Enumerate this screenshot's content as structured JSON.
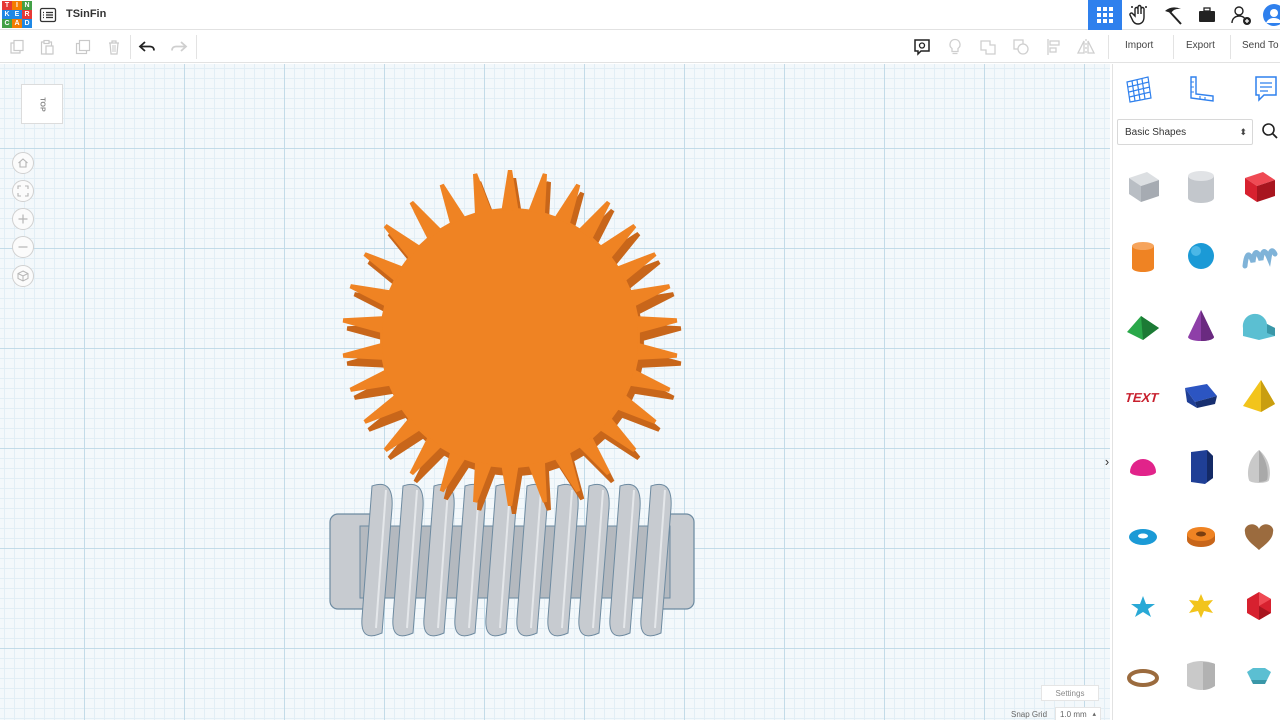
{
  "app": {
    "logo_letters": [
      "T",
      "I",
      "N",
      "K",
      "E",
      "R",
      "C",
      "A",
      "D"
    ],
    "logo_colors": [
      "#e53935",
      "#f57c00",
      "#43a047",
      "#1e88e5",
      "#1e88e5",
      "#e53935",
      "#43a047",
      "#f57c00",
      "#1e88e5"
    ],
    "design_title": "TSinFin"
  },
  "topbar": {
    "icons": [
      {
        "name": "3d-design-icon",
        "active": true
      },
      {
        "name": "blocks-icon",
        "active": false
      },
      {
        "name": "lessons-pickaxe-icon",
        "active": false
      },
      {
        "name": "circuits-briefcase-icon",
        "active": false
      },
      {
        "name": "invite-user-icon",
        "active": false
      },
      {
        "name": "user-avatar-icon",
        "active": false
      }
    ]
  },
  "toolbar": {
    "copy": "copy-icon",
    "paste": "paste-icon",
    "duplicate": "duplicate-icon",
    "delete": "delete-icon",
    "undo": "undo-icon",
    "redo": "redo-icon",
    "notes": "notes-icon",
    "light": "lightbulb-icon",
    "group": "group-icon",
    "ungroup": "ungroup-icon",
    "align": "align-icon",
    "mirror": "mirror-icon",
    "import_label": "Import",
    "export_label": "Export",
    "send_label": "Send To"
  },
  "viewport": {
    "view_label": "TOP",
    "nav": [
      "home-view-icon",
      "fit-view-icon",
      "zoom-in-icon",
      "zoom-out-icon",
      "perspective-icon"
    ],
    "settings_label": "Settings",
    "snap_label": "Snap Grid",
    "snap_value": "1.0 mm"
  },
  "objects": {
    "gear_color": "#ef8323",
    "gear_shadow": "#c8661a",
    "gear_teeth": 30,
    "worm_color": "#c7cbd0",
    "worm_edge": "#6d8aa0",
    "worm_threads": 10
  },
  "panel": {
    "tabs": [
      "workplane-icon",
      "ruler-icon",
      "notes-panel-icon"
    ],
    "library": "Basic Shapes",
    "shapes": [
      {
        "name": "box-hole",
        "color": "#b9bec4"
      },
      {
        "name": "cylinder-hole",
        "color": "#c3c7cc"
      },
      {
        "name": "box",
        "color": "#d7212f"
      },
      {
        "name": "cylinder",
        "color": "#ef8323"
      },
      {
        "name": "sphere",
        "color": "#1b9ad6"
      },
      {
        "name": "scribble",
        "color": "#7fb3d8"
      },
      {
        "name": "roof",
        "color": "#2aa84a"
      },
      {
        "name": "cone",
        "color": "#8e3fa8"
      },
      {
        "name": "round-roof",
        "color": "#5bbfd2"
      },
      {
        "name": "text",
        "color": "#c8202e"
      },
      {
        "name": "wedge",
        "color": "#1f3f96"
      },
      {
        "name": "pyramid",
        "color": "#f2c41c"
      },
      {
        "name": "half-sphere",
        "color": "#e1238a"
      },
      {
        "name": "polygon",
        "color": "#1f3f96"
      },
      {
        "name": "paraboloid",
        "color": "#c9c9c9"
      },
      {
        "name": "torus",
        "color": "#1b9ad6"
      },
      {
        "name": "tube",
        "color": "#ef8323"
      },
      {
        "name": "heart",
        "color": "#9b6b3e"
      },
      {
        "name": "star",
        "color": "#29a9d6"
      },
      {
        "name": "star-six",
        "color": "#f2c41c"
      },
      {
        "name": "icosahedron",
        "color": "#d7212f"
      },
      {
        "name": "ring",
        "color": "#9b6b3e"
      },
      {
        "name": "round-box",
        "color": "#c9c9c9"
      },
      {
        "name": "gem",
        "color": "#5bbfd2"
      }
    ]
  }
}
